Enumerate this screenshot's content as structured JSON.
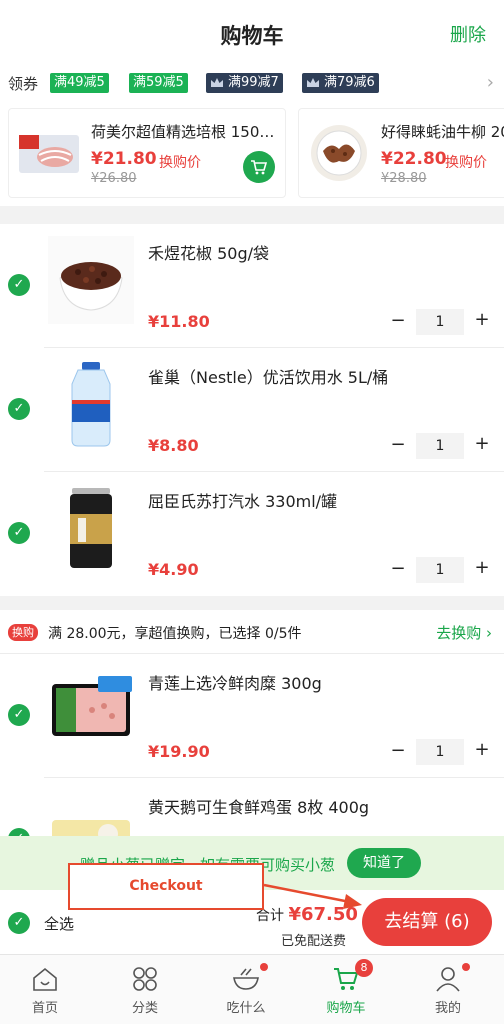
{
  "header": {
    "title": "购物车",
    "delete_label": "删除"
  },
  "coupons": {
    "label": "领券",
    "items": [
      {
        "text": "满49减5",
        "style": "green"
      },
      {
        "text": "满59减5",
        "style": "green"
      },
      {
        "text": "满99减7",
        "style": "member"
      },
      {
        "text": "满79减6",
        "style": "member"
      }
    ]
  },
  "swap_offers": [
    {
      "name": "荷美尔超值精选培根 150…",
      "price": "¥21.80",
      "tag": "换购价",
      "original": "¥26.80"
    },
    {
      "name": "好得睐蚝油牛柳 20",
      "price": "¥22.80",
      "tag": "换购价",
      "original": "¥28.80"
    }
  ],
  "items": [
    {
      "name": "禾煜花椒 50g/袋",
      "price": "¥11.80",
      "qty": "1"
    },
    {
      "name": "雀巢（Nestle）优活饮用水 5L/桶",
      "price": "¥8.80",
      "qty": "1"
    },
    {
      "name": "屈臣氏苏打汽水 330ml/罐",
      "price": "¥4.90",
      "qty": "1"
    }
  ],
  "swap_section": {
    "tag": "换购",
    "text": "满 28.00元，享超值换购，已选择 0/5件",
    "link": "去换购 ›",
    "items": [
      {
        "name": "青莲上选冷鲜肉糜 300g",
        "price": "¥19.90",
        "qty": "1"
      },
      {
        "name": "黄天鹅可生食鲜鸡蛋 8枚 400g"
      }
    ]
  },
  "toast": {
    "text": "赠品小葱已赠完，如有需要可购买小葱",
    "button": "知道了"
  },
  "annotation": {
    "label": "Checkout"
  },
  "checkout": {
    "select_all": "全选",
    "total_label": "合计",
    "total_amount": "¥67.50",
    "shipping": "已免配送费",
    "pay_button": "去结算 (6)"
  },
  "tabbar": {
    "tabs": [
      {
        "label": "首页",
        "icon": "home-icon"
      },
      {
        "label": "分类",
        "icon": "category-icon"
      },
      {
        "label": "吃什么",
        "icon": "bowl-icon"
      },
      {
        "label": "购物车",
        "icon": "cart-icon"
      },
      {
        "label": "我的",
        "icon": "profile-icon"
      }
    ],
    "active": "购物车",
    "cart_badge": "8"
  },
  "colors": {
    "accent": "#1aa64a",
    "price": "#e8403c",
    "annotation": "#e64a2e"
  }
}
